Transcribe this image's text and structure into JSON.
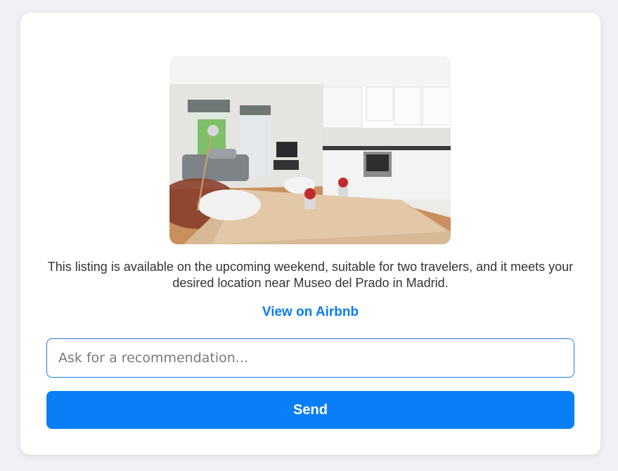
{
  "listing": {
    "photo_icon": "apartment-photo",
    "description": "This listing is available on the upcoming weekend, suitable for two travelers, and it meets your desired location near Museo del Prado in Madrid.",
    "link_label": "View on Airbnb"
  },
  "chat": {
    "placeholder": "Ask for a recommendation...",
    "value": "",
    "send_label": "Send"
  },
  "colors": {
    "accent": "#0a7ef7",
    "link": "#0a7cf0",
    "card": "#ffffff",
    "background": "#f0f1f5"
  }
}
